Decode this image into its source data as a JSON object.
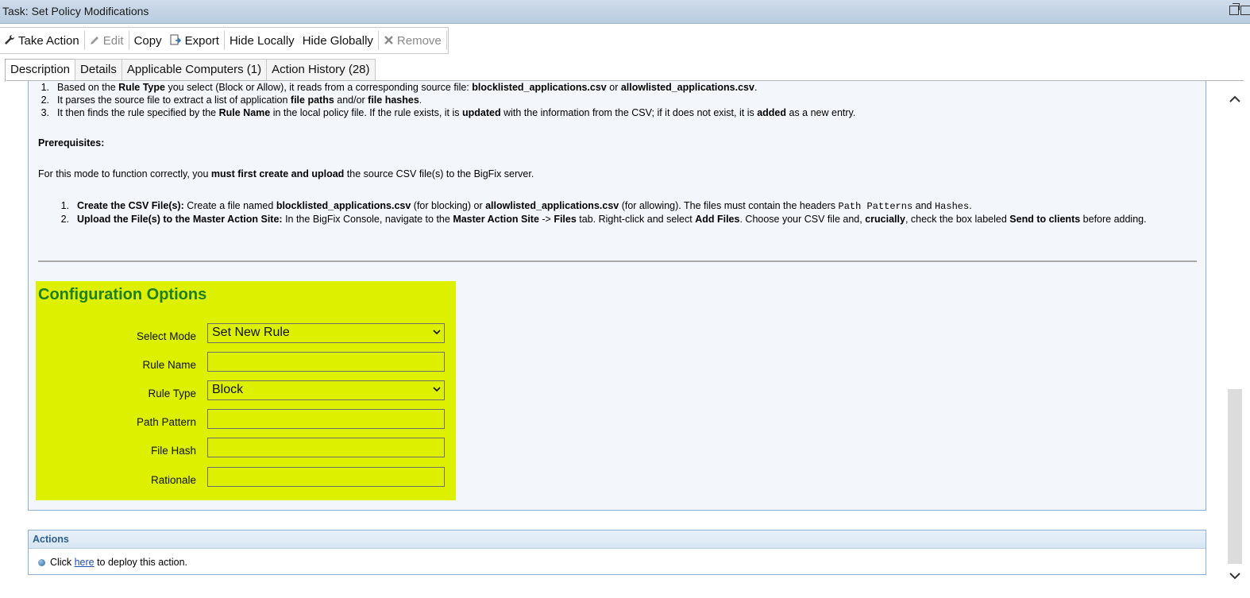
{
  "window": {
    "title": "Task: Set Policy Modifications"
  },
  "toolbar": {
    "take_action": "Take Action",
    "edit": "Edit",
    "copy": "Copy",
    "export": "Export",
    "hide_locally": "Hide Locally",
    "hide_globally": "Hide Globally",
    "remove": "Remove"
  },
  "tabs": [
    {
      "label": "Description",
      "active": true
    },
    {
      "label": "Details"
    },
    {
      "label": "Applicable Computers (1)"
    },
    {
      "label": "Action History (28)"
    }
  ],
  "description": {
    "steps": [
      {
        "num": "1.",
        "t1": "Based on the ",
        "b1": "Rule Type",
        "t2": " you select (Block or Allow), it reads from a corresponding source file: ",
        "b2": "blocklisted_applications.csv",
        "t3": " or ",
        "b3": "allowlisted_applications.csv",
        "t4": "."
      },
      {
        "num": "2.",
        "t1": "It parses the source file to extract a list of application ",
        "b1": "file paths",
        "t2": " and/or ",
        "b2": "file hashes",
        "t3": "."
      },
      {
        "num": "3.",
        "t1": "It then finds the rule specified by the ",
        "b1": "Rule Name",
        "t2": " in the local policy file. If the rule exists, it is ",
        "b2": "updated",
        "t3": " with the information from the CSV; if it does not exist, it is ",
        "b3": "added",
        "t4": " as a new entry."
      }
    ],
    "prereq_heading": "Prerequisites:",
    "prereq_text": {
      "t1": "For this mode to function correctly, you ",
      "b1": "must first create and upload",
      "t2": " the source CSV file(s) to the BigFix server."
    },
    "prereq_steps": [
      {
        "num": "1.",
        "b1": "Create the CSV File(s):",
        "t1": " Create a file named ",
        "b2": "blocklisted_applications.csv",
        "t2": " (for blocking) or ",
        "b3": "allowlisted_applications.csv",
        "t3": " (for allowing). The files must contain the headers ",
        "m1": "Path Patterns",
        "t4": " and ",
        "m2": "Hashes",
        "t5": "."
      },
      {
        "num": "2.",
        "b1": "Upload the File(s) to the Master Action Site:",
        "t1": " In the BigFix Console, navigate to the ",
        "b2": "Master Action Site",
        "t2": " -> ",
        "b3": "Files",
        "t3": " tab. Right-click and select ",
        "b4": "Add Files",
        "t4": ". Choose your CSV file and, ",
        "b5": "crucially",
        "t5": ", check the box labeled ",
        "b6": "Send to clients",
        "t6": " before adding."
      }
    ]
  },
  "config": {
    "heading": "Configuration Options",
    "fields": {
      "select_mode": {
        "label": "Select Mode",
        "value": "Set New Rule"
      },
      "rule_name": {
        "label": "Rule Name",
        "value": ""
      },
      "rule_type": {
        "label": "Rule Type",
        "value": "Block"
      },
      "path_pattern": {
        "label": "Path Pattern",
        "value": ""
      },
      "file_hash": {
        "label": "File Hash",
        "value": ""
      },
      "rationale": {
        "label": "Rationale",
        "value": ""
      }
    },
    "colors": {
      "background": "#dcf000",
      "heading": "#1f7f1f"
    }
  },
  "actions": {
    "header": "Actions",
    "text_before": "Click ",
    "link": "here",
    "text_after": " to deploy this action."
  }
}
